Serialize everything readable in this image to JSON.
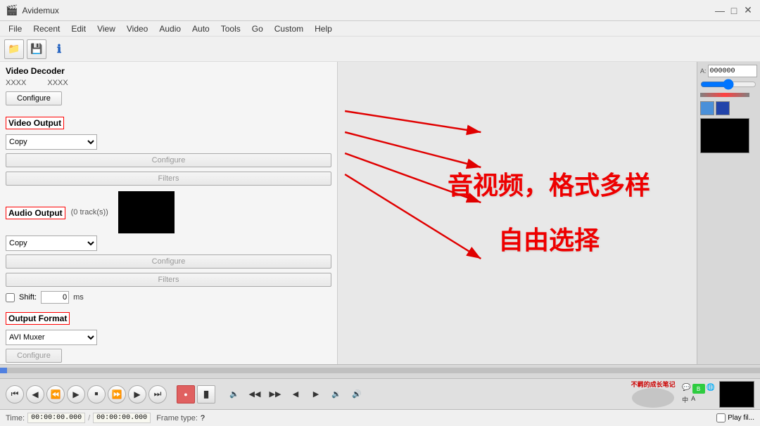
{
  "app": {
    "title": "Avidemux",
    "title_bar_text": "Avidemux"
  },
  "titlebar": {
    "minimize": "—",
    "maximize": "□",
    "close": "✕"
  },
  "menubar": {
    "items": [
      {
        "label": "File"
      },
      {
        "label": "Recent"
      },
      {
        "label": "Edit"
      },
      {
        "label": "View"
      },
      {
        "label": "Video"
      },
      {
        "label": "Audio"
      },
      {
        "label": "Auto"
      },
      {
        "label": "Tools"
      },
      {
        "label": "Go"
      },
      {
        "label": "Custom"
      },
      {
        "label": "Help"
      }
    ]
  },
  "video_decoder": {
    "section_label": "Video Decoder",
    "codec1": "XXXX",
    "codec2": "XXXX",
    "configure_btn": "Configure"
  },
  "video_output": {
    "section_label": "Video Output",
    "codec": "Copy",
    "configure_btn": "Configure",
    "filters_btn": "Filters"
  },
  "audio_output": {
    "section_label": "Audio Output",
    "tracks": "(0 track(s))",
    "codec": "Copy",
    "configure_btn": "Configure",
    "filters_btn": "Filters",
    "shift_label": "Shift:",
    "shift_value": "0",
    "shift_unit": "ms"
  },
  "output_format": {
    "section_label": "Output Format",
    "format": "AVI Muxer",
    "configure_btn": "Configure"
  },
  "annotation": {
    "line1": "音视频，格式多样",
    "line2": "自由选择"
  },
  "status_bar": {
    "time_label": "Time:",
    "time_value": "00:00:00.000",
    "separator": "/",
    "total_time": "00:00:00.000",
    "frame_label": "Frame type:",
    "frame_value": "?",
    "play_file_label": "Play fil..."
  },
  "right_panel": {
    "a_label": "A:",
    "a_value": "000000",
    "slider_label": ""
  },
  "player_buttons": [
    {
      "name": "play-btn",
      "icon": "▶"
    },
    {
      "name": "pause-btn",
      "icon": "⏸"
    },
    {
      "name": "rewind-btn",
      "icon": "◀◀"
    },
    {
      "name": "forward-btn",
      "icon": "▶▶"
    },
    {
      "name": "prev-frame-btn",
      "icon": "◀"
    },
    {
      "name": "next-frame-btn",
      "icon": "▶"
    },
    {
      "name": "stop-btn",
      "icon": "■"
    },
    {
      "name": "record-btn",
      "icon": "●"
    },
    {
      "name": "mark-a-btn",
      "icon": "["
    },
    {
      "name": "mark-b-btn",
      "icon": "]"
    },
    {
      "name": "vol-down-btn",
      "icon": "🔉"
    },
    {
      "name": "vol-up-btn",
      "icon": "🔊"
    },
    {
      "name": "fullscreen-btn",
      "icon": "⛶"
    }
  ],
  "colors": {
    "accent_red": "#e00000",
    "border_red": "#cc0000",
    "timeline_blue": "#5080e0",
    "black": "#000000",
    "bg_gray": "#f0f0f0",
    "panel_bg": "#e8e8e8"
  }
}
